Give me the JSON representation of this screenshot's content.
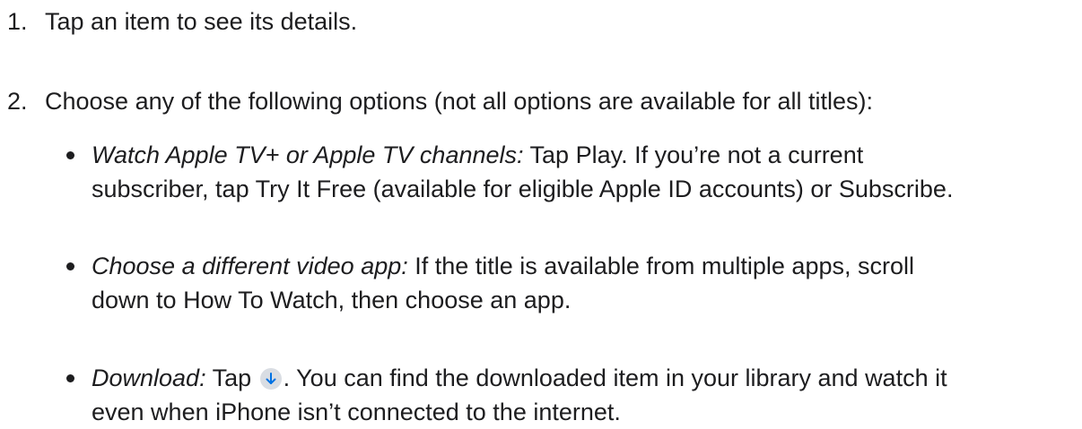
{
  "steps": [
    {
      "num": "1.",
      "text": "Tap an item to see its details."
    },
    {
      "num": "2.",
      "text": "Choose any of the following options (not all options are available for all titles):"
    }
  ],
  "bullets": [
    {
      "term": "Watch Apple TV+ or Apple TV channels:",
      "line1": " Tap Play. If you’re not a current",
      "line2": "subscriber, tap Try It Free (available for eligible Apple ID accounts) or Subscribe."
    },
    {
      "term": "Choose a different video app:",
      "line1": " If the title is available from multiple apps, scroll",
      "line2": "down to How To Watch, then choose an app."
    },
    {
      "term": "Download:",
      "line1_pre": " Tap ",
      "icon": "download-icon",
      "line1_post": ". You can find the downloaded item in your library and watch it",
      "line2": "even when iPhone isn’t connected to the internet."
    }
  ],
  "colors": {
    "text": "#1d1d1f",
    "icon_bg": "#d9dde3",
    "icon_arrow": "#0071e3"
  }
}
